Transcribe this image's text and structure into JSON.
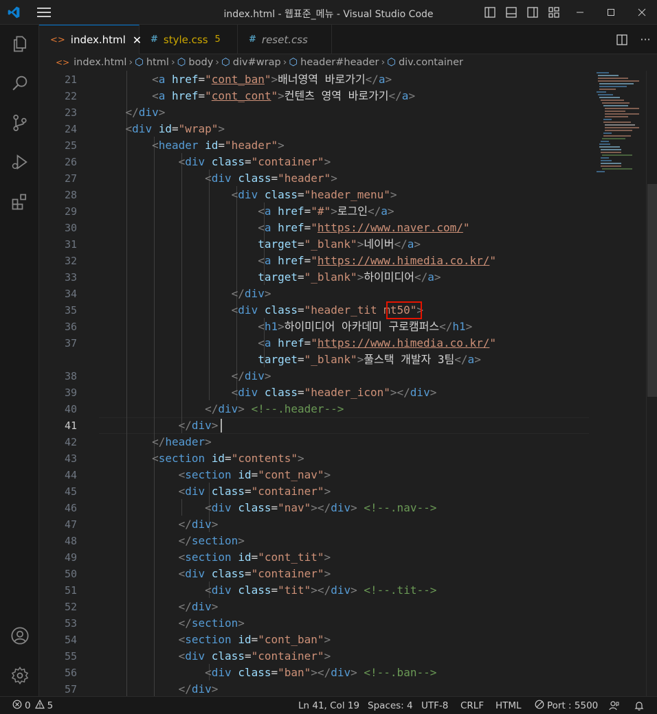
{
  "window": {
    "title": "index.html - 웹표준_메뉴 - Visual Studio Code"
  },
  "tabs": [
    {
      "label": "index.html",
      "icon": "html-file-icon",
      "active": true
    },
    {
      "label": "style.css",
      "badge": "5",
      "icon": "css-file-icon",
      "active": false
    },
    {
      "label": "reset.css",
      "icon": "css-file-icon",
      "active": false
    }
  ],
  "breadcrumb": [
    "index.html",
    "html",
    "body",
    "div#wrap",
    "header#header",
    "div.container"
  ],
  "editor": {
    "current_line": "41",
    "highlighted_token": "mt50",
    "lines": [
      {
        "n": "21"
      },
      {
        "n": "22"
      },
      {
        "n": "23"
      },
      {
        "n": "24"
      },
      {
        "n": "25"
      },
      {
        "n": "26"
      },
      {
        "n": "27"
      },
      {
        "n": "28"
      },
      {
        "n": "29"
      },
      {
        "n": "30"
      },
      {
        "n": ""
      },
      {
        "n": "32"
      },
      {
        "n": "33"
      },
      {
        "n": "34"
      },
      {
        "n": "35"
      },
      {
        "n": "36"
      },
      {
        "n": "37"
      },
      {
        "n": ""
      },
      {
        "n": "38"
      },
      {
        "n": "39"
      },
      {
        "n": "40"
      },
      {
        "n": "41"
      },
      {
        "n": "42"
      },
      {
        "n": "43"
      },
      {
        "n": "44"
      },
      {
        "n": "45"
      },
      {
        "n": "46"
      },
      {
        "n": "47"
      },
      {
        "n": "48"
      },
      {
        "n": "49"
      },
      {
        "n": "50"
      },
      {
        "n": "51"
      },
      {
        "n": "52"
      },
      {
        "n": "53"
      },
      {
        "n": "54"
      },
      {
        "n": "55"
      },
      {
        "n": "56"
      },
      {
        "n": "57"
      }
    ]
  },
  "statusbar": {
    "errors": "0",
    "warnings": "5",
    "position": "Ln 41, Col 19",
    "spaces": "Spaces: 4",
    "encoding": "UTF-8",
    "eol": "CRLF",
    "language": "HTML",
    "port": "Port : 5500"
  },
  "colors": {
    "accent": "#0078d4",
    "tag": "#569cd6",
    "attribute": "#9cdcfe",
    "string": "#ce9178",
    "comment": "#6a9955",
    "highlight_box": "#e51400"
  }
}
